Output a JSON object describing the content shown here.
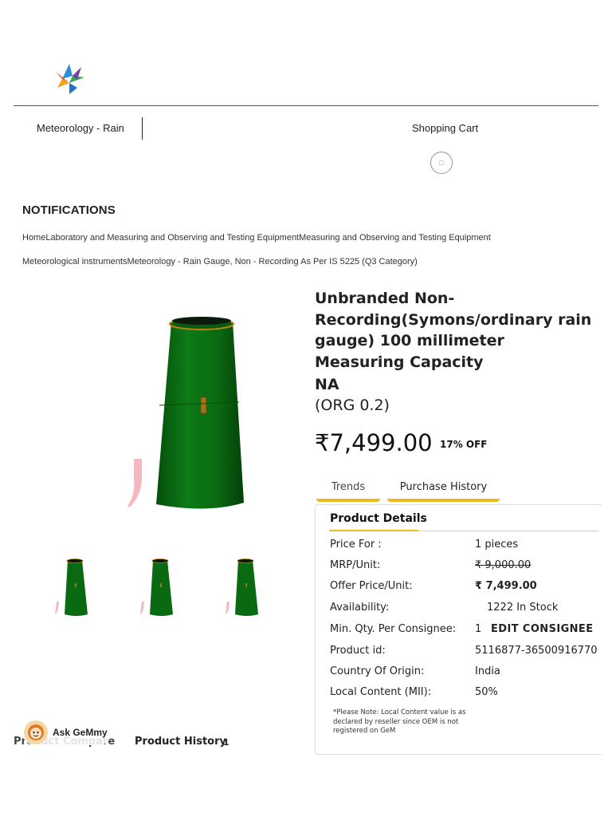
{
  "header": {
    "logo_icon": "gem-star-logo-icon",
    "category": "Meteorology - Rain",
    "cart_label": "Shopping Cart",
    "cart_icon": "cart-icon"
  },
  "notifications_heading": "NOTIFICATIONS",
  "breadcrumb": {
    "line1": "HomeLaboratory and Measuring and Observing and Testing EquipmentMeasuring and Observing and Testing Equipment",
    "line2": "Meteorological instrumentsMeteorology - Rain Gauge, Non - Recording As Per IS 5225 (Q3 Category)"
  },
  "product": {
    "title": "Unbranded Non-Recording(Symons/ordinary rain gauge) 100 millimeter Measuring Capacity",
    "brand": "NA",
    "org": "(ORG 0.2)",
    "price": "₹7,499.00",
    "discount": "17% OFF"
  },
  "tabs": [
    {
      "label": "Trends"
    },
    {
      "label": "Purchase History"
    }
  ],
  "details": {
    "heading": "Product Details",
    "rows": [
      {
        "label": "Price For :",
        "value": "1   pieces"
      },
      {
        "label": "MRP/Unit:",
        "value": "₹ 9,000.00"
      },
      {
        "label": "Offer Price/Unit:",
        "value": "₹ 7,499.00"
      },
      {
        "label": "Availability:",
        "value": "1222 In Stock"
      },
      {
        "label": "Min. Qty. Per Consignee:",
        "value": "1",
        "action": "EDIT CONSIGNEE"
      },
      {
        "label": "Product id:",
        "value": "5116877-36500916770"
      },
      {
        "label": "Country Of Origin:",
        "value": "India"
      },
      {
        "label": "Local Content (MII):",
        "value": "50%"
      }
    ],
    "note": "*Please Note: Local Content value is as declared by reseller since OEM is not registered on GeM"
  },
  "bottom": {
    "compare_label": "Product Compare",
    "history_label": "Product History",
    "history_count": "1"
  },
  "assistant": {
    "label": "Ask GeMmy",
    "icon": "gemmy-avatar-icon"
  },
  "colors": {
    "accent": "#f0b823",
    "product_green": "#0a6a12"
  }
}
